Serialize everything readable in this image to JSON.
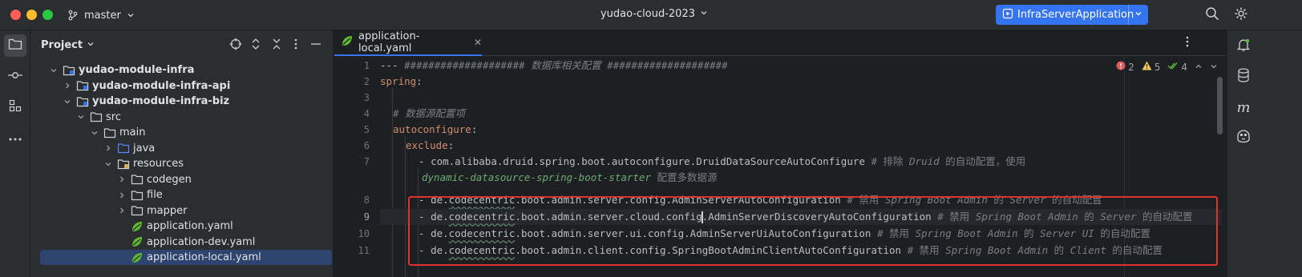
{
  "titlebar": {
    "branch": "master",
    "project": "yudao-cloud-2023",
    "run_config": "InfraServerApplication"
  },
  "project_panel": {
    "title": "Project",
    "tree": [
      {
        "label": "yudao-module-infra",
        "bold": true,
        "expanded": true,
        "icon": "module-folder-icon"
      },
      {
        "label": "yudao-module-infra-api",
        "bold": true,
        "expanded": false,
        "icon": "module-folder-icon"
      },
      {
        "label": "yudao-module-infra-biz",
        "bold": true,
        "expanded": true,
        "icon": "module-folder-icon"
      },
      {
        "label": "src",
        "expanded": true,
        "icon": "folder-icon"
      },
      {
        "label": "main",
        "expanded": true,
        "icon": "folder-icon"
      },
      {
        "label": "java",
        "expanded": false,
        "icon": "source-folder-icon"
      },
      {
        "label": "resources",
        "expanded": true,
        "icon": "resources-folder-icon"
      },
      {
        "label": "codegen",
        "expanded": false,
        "icon": "folder-icon"
      },
      {
        "label": "file",
        "expanded": false,
        "icon": "folder-icon"
      },
      {
        "label": "mapper",
        "expanded": false,
        "icon": "folder-icon"
      },
      {
        "label": "application.yaml",
        "icon": "spring-yaml-icon"
      },
      {
        "label": "application-dev.yaml",
        "icon": "spring-yaml-icon"
      },
      {
        "label": "application-local.yaml",
        "icon": "spring-yaml-icon",
        "selected": true
      }
    ]
  },
  "editor": {
    "tab_label": "application-local.yaml",
    "inspections": {
      "errors": "2",
      "warnings": "5",
      "weak": "4"
    },
    "current_line": "9",
    "line_numbers": [
      "1",
      "2",
      "3",
      "4",
      "5",
      "6",
      "7",
      "",
      "8",
      "9",
      "10",
      "11"
    ],
    "lines": {
      "l1_prefix": "--- ",
      "l1_comment": "#################### 数据库相关配置 ####################",
      "l2_key": "spring",
      "l2_colon": ":",
      "l4_comment": "# 数据源配置项",
      "l5_key": "autoconfigure",
      "l5_colon": ":",
      "l6_key": "exclude",
      "l6_colon": ":",
      "l7_dash": "- ",
      "l7_value": "com.alibaba.druid.spring.boot.autoconfigure.DruidDataSourceAutoConfigure",
      "l7_comment_a": " # 排除 ",
      "l7_comment_b": "Druid",
      "l7_comment_c": " 的自动配置，使用",
      "l7b_comment_a": "dynamic-datasource-spring-boot-starter",
      "l7b_comment_b": " 配置多数据源",
      "l8_dash": "- ",
      "l8_v1": "de.",
      "l8_v2": "codecentric",
      "l8_v3": ".boot.admin.server.config.AdminServerAutoConfiguration",
      "l8_c1": " # 禁用 ",
      "l8_c2": "Spring Boot Admin",
      "l8_c3": " 的 ",
      "l8_c4": "Server",
      "l8_c5": " 的自动配置",
      "l9_dash": "- ",
      "l9_v1": "de.",
      "l9_v2": "codecentric",
      "l9_v3": ".boot.admin.server.cloud.config",
      "l9_v4": ".AdminServerDiscoveryAutoConfiguration",
      "l9_c1": " # 禁用 ",
      "l9_c2": "Spring Boot Admin",
      "l9_c3": " 的 ",
      "l9_c4": "Server",
      "l9_c5": " 的自动配置",
      "l10_dash": "- ",
      "l10_v1": "de.",
      "l10_v2": "codecentric",
      "l10_v3": ".boot.admin.server.ui.config.AdminServerUiAutoConfiguration",
      "l10_c1": " # 禁用 ",
      "l10_c2": "Spring Boot Admin",
      "l10_c3": " 的 ",
      "l10_c4": "Server UI",
      "l10_c5": " 的自动配置",
      "l11_dash": "- ",
      "l11_v1": "de.",
      "l11_v2": "codecentric",
      "l11_v3": ".boot.admin.client.config.SpringBootAdminClientAutoConfiguration",
      "l11_c1": " # 禁用 ",
      "l11_c2": "Spring Boot Admin",
      "l11_c3": " 的 ",
      "l11_c4": "Client",
      "l11_c5": " 的自动配置"
    }
  },
  "colors": {
    "accent": "#3574f0",
    "annotation_box": "#e0312d",
    "keyword": "#cf8e6d",
    "comment": "#7a7e85"
  }
}
